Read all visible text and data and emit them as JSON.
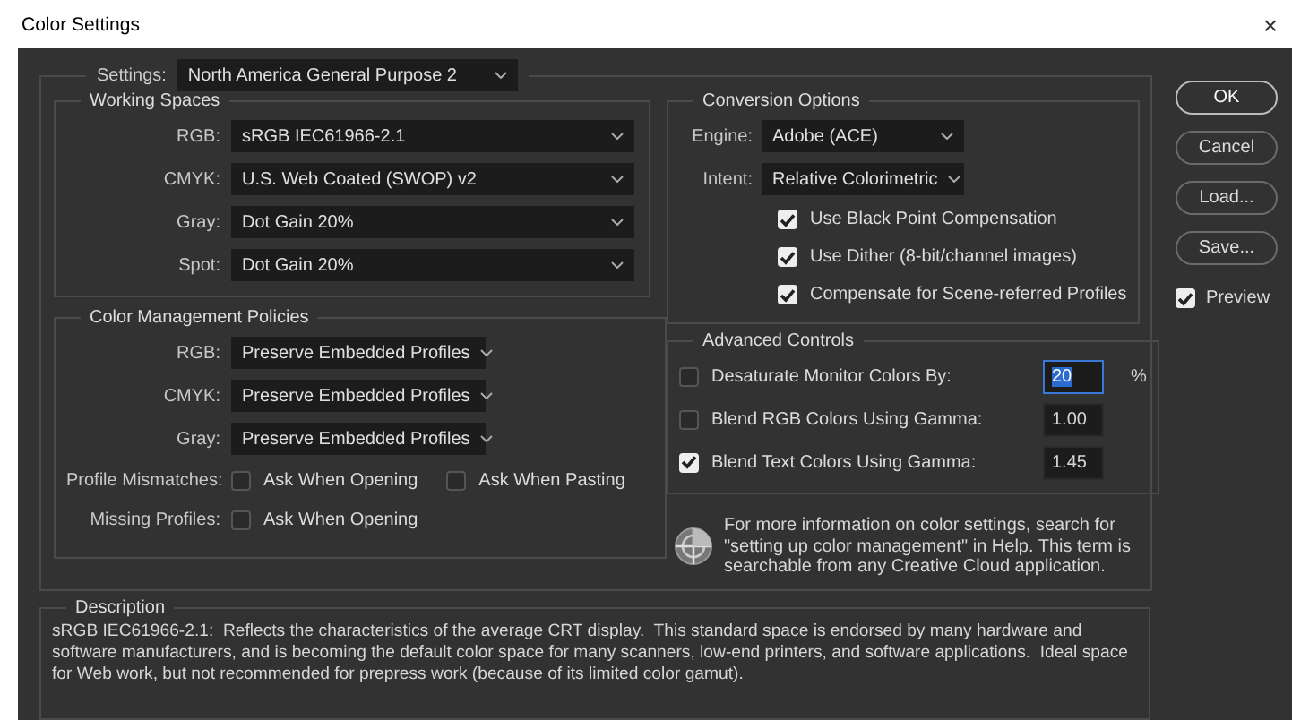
{
  "window": {
    "title": "Color Settings",
    "close": "×"
  },
  "settings": {
    "label": "Settings:",
    "value": "North America General Purpose 2"
  },
  "working_spaces": {
    "title": "Working Spaces",
    "rows": [
      {
        "label": "RGB:",
        "value": "sRGB IEC61966-2.1"
      },
      {
        "label": "CMYK:",
        "value": "U.S. Web Coated (SWOP) v2"
      },
      {
        "label": "Gray:",
        "value": "Dot Gain 20%"
      },
      {
        "label": "Spot:",
        "value": "Dot Gain 20%"
      }
    ]
  },
  "policies": {
    "title": "Color Management Policies",
    "rows": [
      {
        "label": "RGB:",
        "value": "Preserve Embedded Profiles"
      },
      {
        "label": "CMYK:",
        "value": "Preserve Embedded Profiles"
      },
      {
        "label": "Gray:",
        "value": "Preserve Embedded Profiles"
      }
    ],
    "checks": [
      {
        "label": "Profile Mismatches:",
        "options": [
          {
            "label": "Ask When Opening",
            "checked": false
          },
          {
            "label": "Ask When Pasting",
            "checked": false
          }
        ]
      },
      {
        "label": "Missing Profiles:",
        "options": [
          {
            "label": "Ask When Opening",
            "checked": false
          }
        ]
      }
    ]
  },
  "conversion": {
    "title": "Conversion Options",
    "rows": [
      {
        "label": "Engine:",
        "value": "Adobe (ACE)"
      },
      {
        "label": "Intent:",
        "value": "Relative Colorimetric"
      }
    ],
    "options": [
      {
        "label": "Use Black Point Compensation",
        "checked": true
      },
      {
        "label": "Use Dither (8-bit/channel images)",
        "checked": true
      },
      {
        "label": "Compensate for Scene-referred Profiles",
        "checked": true
      }
    ]
  },
  "advanced": {
    "title": "Advanced Controls",
    "rows": [
      {
        "label": "Desaturate Monitor Colors By:",
        "checked": false,
        "value": "20",
        "highlighted": true,
        "unit": "%"
      },
      {
        "label": "Blend RGB Colors Using Gamma:",
        "checked": false,
        "value": "1.00",
        "highlighted": false
      },
      {
        "label": "Blend Text Colors Using Gamma:",
        "checked": true,
        "value": "1.45",
        "highlighted": false
      }
    ]
  },
  "info": {
    "text": "For more information on color settings, search for \"setting up color management\" in Help. This term is searchable from any Creative Cloud application."
  },
  "description": {
    "title": "Description",
    "text": "sRGB IEC61966-2.1:  Reflects the characteristics of the average CRT display.  This standard space is endorsed by many hardware and software manufacturers, and is becoming the default color space for many scanners, low-end printers, and software applications.  Ideal space for Web work, but not recommended for prepress work (because of its limited color gamut)."
  },
  "buttons": [
    {
      "label": "OK",
      "default": true
    },
    {
      "label": "Cancel",
      "default": false
    },
    {
      "label": "Load...",
      "default": false
    },
    {
      "label": "Save...",
      "default": false
    }
  ],
  "preview": {
    "label": "Preview",
    "checked": true
  }
}
